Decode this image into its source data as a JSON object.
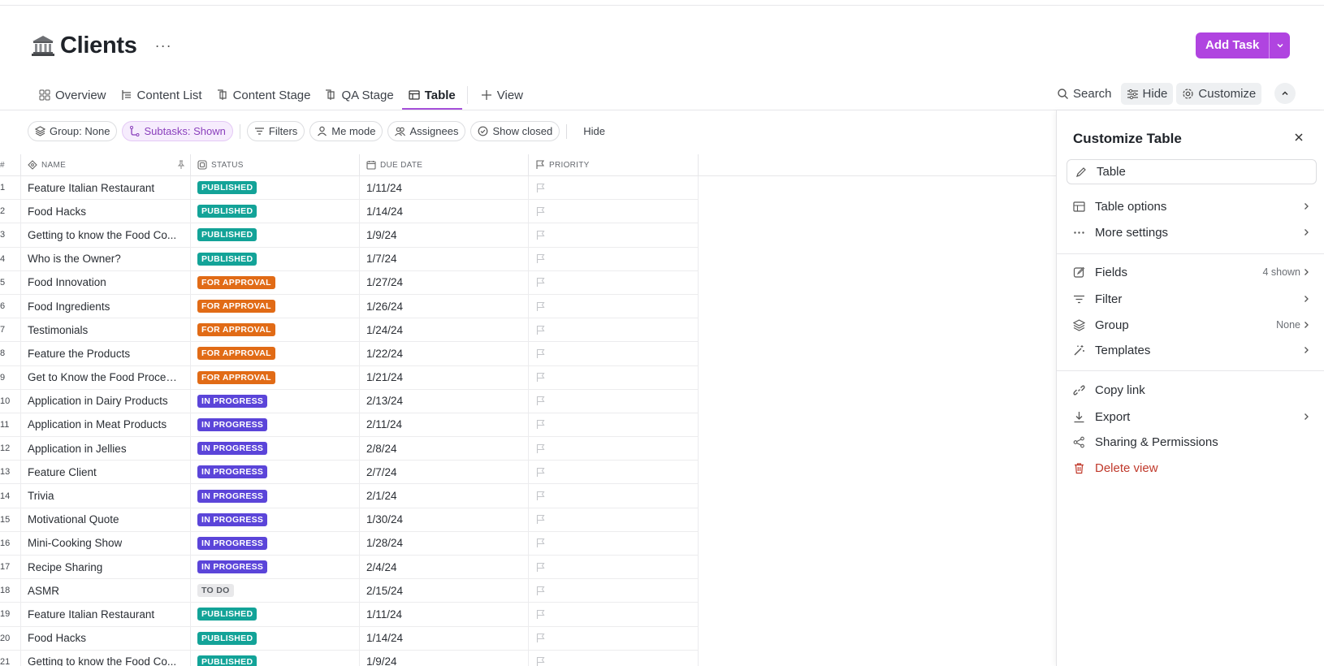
{
  "page": {
    "title": "Clients",
    "more": "···"
  },
  "add_task": {
    "label": "Add Task"
  },
  "tabs": [
    {
      "label": "Overview",
      "icon": "overview-icon"
    },
    {
      "label": "Content List",
      "icon": "list-icon"
    },
    {
      "label": "Content Stage",
      "icon": "board-icon"
    },
    {
      "label": "QA Stage",
      "icon": "board-icon"
    },
    {
      "label": "Table",
      "icon": "table-icon",
      "active": true
    },
    {
      "label": "View",
      "icon": "plus-icon"
    }
  ],
  "tools": {
    "search": "Search",
    "hide": "Hide",
    "customize": "Customize"
  },
  "filters": {
    "group": "Group: None",
    "subtasks": "Subtasks: Shown",
    "filters": "Filters",
    "me_mode": "Me mode",
    "assignees": "Assignees",
    "show_closed": "Show closed",
    "hide": "Hide"
  },
  "table": {
    "headers": {
      "num": "#",
      "name": "NAME",
      "status": "STATUS",
      "due": "DUE DATE",
      "priority": "PRIORITY"
    },
    "rows": [
      {
        "n": "1",
        "name": "Feature Italian Restaurant",
        "status": "PUBLISHED",
        "due": "1/11/24"
      },
      {
        "n": "2",
        "name": "Food Hacks",
        "status": "PUBLISHED",
        "due": "1/14/24"
      },
      {
        "n": "3",
        "name": "Getting to know the Food Co...",
        "status": "PUBLISHED",
        "due": "1/9/24"
      },
      {
        "n": "4",
        "name": "Who is the Owner?",
        "status": "PUBLISHED",
        "due": "1/7/24"
      },
      {
        "n": "5",
        "name": "Food Innovation",
        "status": "FOR APPROVAL",
        "due": "1/27/24"
      },
      {
        "n": "6",
        "name": "Food Ingredients",
        "status": "FOR APPROVAL",
        "due": "1/26/24"
      },
      {
        "n": "7",
        "name": "Testimonials",
        "status": "FOR APPROVAL",
        "due": "1/24/24"
      },
      {
        "n": "8",
        "name": "Feature the Products",
        "status": "FOR APPROVAL",
        "due": "1/22/24"
      },
      {
        "n": "9",
        "name": "Get to Know the Food Processi...",
        "status": "FOR APPROVAL",
        "due": "1/21/24"
      },
      {
        "n": "10",
        "name": "Application in Dairy Products",
        "status": "IN PROGRESS",
        "due": "2/13/24"
      },
      {
        "n": "11",
        "name": "Application in Meat Products",
        "status": "IN PROGRESS",
        "due": "2/11/24"
      },
      {
        "n": "12",
        "name": "Application in Jellies",
        "status": "IN PROGRESS",
        "due": "2/8/24"
      },
      {
        "n": "13",
        "name": "Feature Client",
        "status": "IN PROGRESS",
        "due": "2/7/24"
      },
      {
        "n": "14",
        "name": "Trivia",
        "status": "IN PROGRESS",
        "due": "2/1/24"
      },
      {
        "n": "15",
        "name": "Motivational Quote",
        "status": "IN PROGRESS",
        "due": "1/30/24"
      },
      {
        "n": "16",
        "name": "Mini-Cooking Show",
        "status": "IN PROGRESS",
        "due": "1/28/24"
      },
      {
        "n": "17",
        "name": "Recipe Sharing",
        "status": "IN PROGRESS",
        "due": "2/4/24"
      },
      {
        "n": "18",
        "name": "ASMR",
        "status": "TO DO",
        "due": "2/15/24"
      },
      {
        "n": "19",
        "name": "Feature Italian Restaurant",
        "status": "PUBLISHED",
        "due": "1/11/24"
      },
      {
        "n": "20",
        "name": "Food Hacks",
        "status": "PUBLISHED",
        "due": "1/14/24"
      },
      {
        "n": "21",
        "name": "Getting to know the Food Co...",
        "status": "PUBLISHED",
        "due": "1/9/24"
      }
    ]
  },
  "status_colors": {
    "PUBLISHED": "#13a398",
    "FOR APPROVAL": "#e16b16",
    "IN PROGRESS": "#5b45d9",
    "TO DO": "#e8e8ea"
  },
  "panel": {
    "title": "Customize Table",
    "view_name": "Table",
    "items": {
      "table_options": "Table options",
      "more_settings": "More settings",
      "fields": "Fields",
      "fields_meta": "4 shown",
      "filter": "Filter",
      "group": "Group",
      "group_meta": "None",
      "templates": "Templates",
      "copy_link": "Copy link",
      "export": "Export",
      "sharing": "Sharing & Permissions",
      "delete": "Delete view"
    }
  }
}
